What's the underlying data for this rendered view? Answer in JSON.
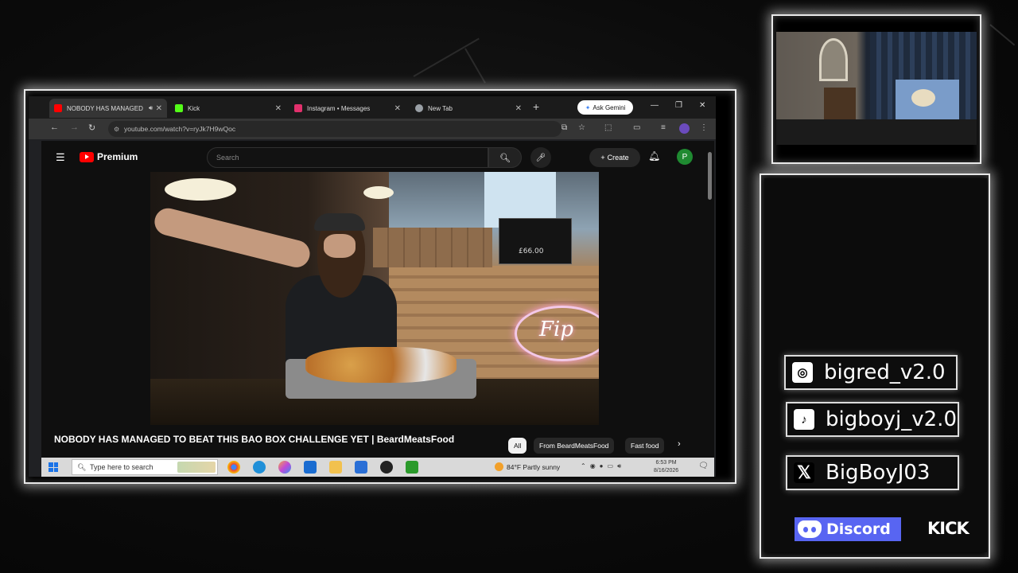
{
  "browser": {
    "tabs": [
      {
        "label": "NOBODY HAS MANAGED",
        "favicon_color": "#ff0000",
        "active": true
      },
      {
        "label": "Kick",
        "favicon_color": "#53fc18",
        "active": false
      },
      {
        "label": "Instagram • Messages",
        "favicon_color": "#e1306c",
        "active": false
      },
      {
        "label": "New Tab",
        "favicon_color": "#9aa0a6",
        "active": false
      }
    ],
    "gemini_label": "Ask Gemini",
    "url": "youtube.com/watch?v=ryJk7H9wQoc"
  },
  "youtube": {
    "logo_label": "Premium",
    "search_placeholder": "Search",
    "create_label": "Create",
    "avatar_letter": "P",
    "video_title": "NOBODY HAS MANAGED TO BEAT THIS BAO BOX CHALLENGE YET | BeardMeatsFood",
    "board_price": "£66.00",
    "neon_text": "Fip",
    "chips": [
      "All",
      "From BeardMeatsFood",
      "Fast food"
    ],
    "selected_chip": "All"
  },
  "taskbar": {
    "search_placeholder": "Type here to search",
    "weather": "84°F Partly sunny",
    "time": "6:53 PM",
    "date": "8/16/2026"
  },
  "socials": {
    "instagram": "bigred_v2.0",
    "tiktok": "bigboyj_v2.0",
    "x": "BigBoyJ03",
    "discord_label": "Discord",
    "kick_label": "KICK"
  },
  "colors": {
    "youtube_red": "#ff0000",
    "discord_blurple": "#5865f2",
    "frame_glow": "#ffffff"
  }
}
